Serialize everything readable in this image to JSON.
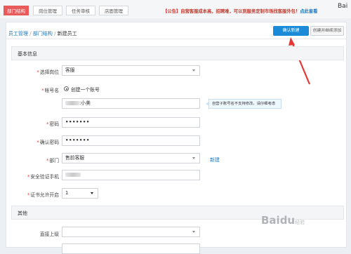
{
  "tabs": [
    {
      "label": "部门结构",
      "active": true
    },
    {
      "label": "岗位管理",
      "active": false
    },
    {
      "label": "任务审核",
      "active": false
    },
    {
      "label": "店面管理",
      "active": false
    }
  ],
  "notice": {
    "prefix": "【公告】",
    "body": "自营客服成本高，招聘难，可以到服务定制市场找客服外包！",
    "link": "点此查看"
  },
  "corner_logo": "Bai",
  "breadcrumb": {
    "items": [
      "员工管理",
      "部门结构"
    ],
    "separator": "/",
    "current": "新建员工"
  },
  "buttons": {
    "confirm": "确认新建",
    "create_continue": "创建并继续添加"
  },
  "sections": {
    "basic": "基本信息",
    "other": "其他"
  },
  "form": {
    "position": {
      "label": "选择岗位",
      "value": "客服"
    },
    "account": {
      "label": "帐号名",
      "option": "创建一个账号",
      "suffix": ":小美"
    },
    "tooltip": "自营子账号名不支持修改，请仔细考虑",
    "password": {
      "label": "密码",
      "value": "•••••••"
    },
    "confirm_password": {
      "label": "确认密码",
      "value": "•••••••"
    },
    "department": {
      "label": "部门",
      "value": "售前客服",
      "new_link": "新建"
    },
    "security_phone": {
      "label": "安全验证手机"
    },
    "certificate": {
      "label": "证书允许开启",
      "value": "1"
    },
    "supervisor": {
      "label": "直接上级",
      "value": ""
    }
  },
  "watermark": {
    "brand": "Baidu",
    "sub": "经验"
  },
  "colors": {
    "accent_red": "#e95b5b",
    "primary_blue": "#1b8bd8",
    "link_blue": "#1a78c2",
    "required_red": "#e13b3b",
    "arrow_red": "#e53935"
  }
}
